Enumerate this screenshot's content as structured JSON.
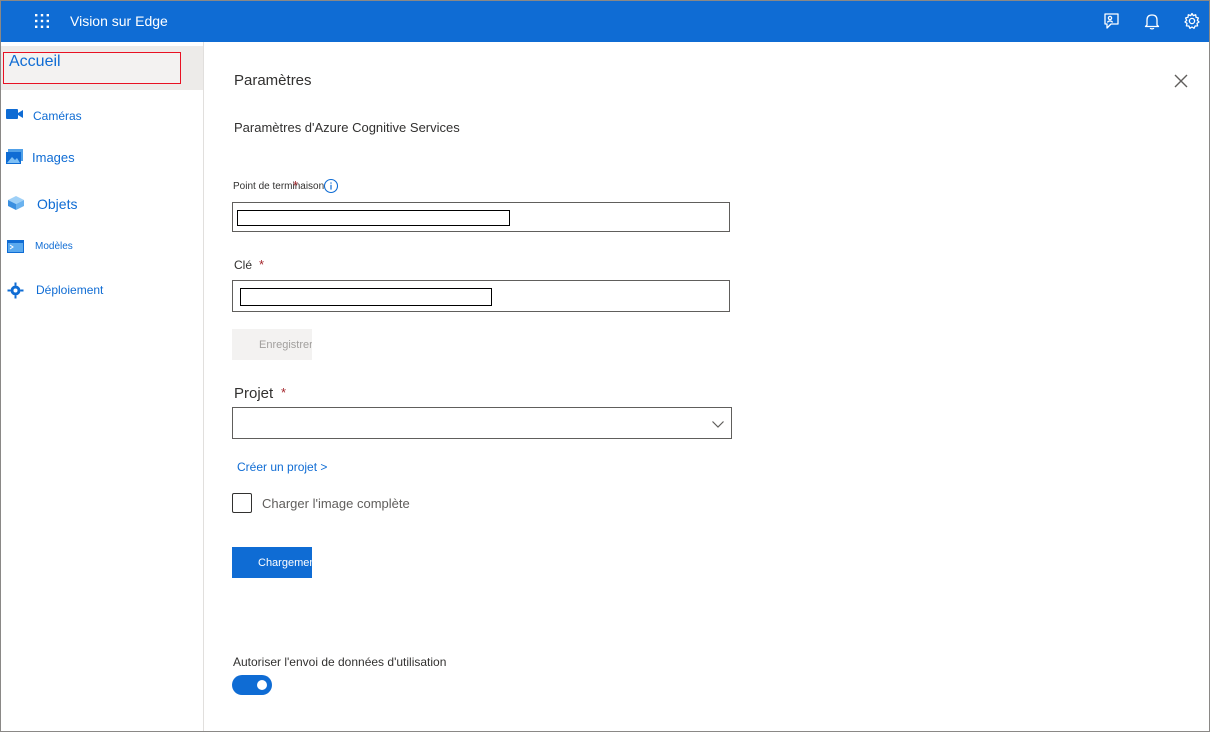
{
  "app": {
    "title": "Vision sur Edge"
  },
  "colors": {
    "accent": "#0f6cd4",
    "required": "#a4262c",
    "highlight_border": "#e81123"
  },
  "header_icons": [
    "waffle-icon",
    "feedback-icon",
    "bell-icon",
    "gear-icon"
  ],
  "sidebar": {
    "home": {
      "label": "Accueil"
    },
    "items": [
      {
        "label": "Caméras",
        "icon": "camera-icon"
      },
      {
        "label": "Images",
        "icon": "images-icon"
      },
      {
        "label": "Objets",
        "icon": "objects-icon"
      },
      {
        "label": "Modèles",
        "icon": "models-icon"
      },
      {
        "label": "Déploiement",
        "icon": "deployment-icon"
      }
    ]
  },
  "panel": {
    "title": "Paramètres",
    "section_title": "Paramètres d'Azure Cognitive Services",
    "endpoint": {
      "label": "Point de terminaison",
      "required_marker": "*",
      "value": ""
    },
    "key": {
      "label": "Clé",
      "required_marker": "*",
      "value": ""
    },
    "save_button": "Enregistrer",
    "project": {
      "label": "Projet",
      "required_marker": "*",
      "selected": ""
    },
    "create_project_link": "Créer un projet >",
    "full_image_checkbox": {
      "label": "Charger l'image complète",
      "checked": false
    },
    "load_button": "Chargement",
    "telemetry": {
      "label": "Autoriser l'envoi de données d'utilisation",
      "enabled": true
    }
  }
}
